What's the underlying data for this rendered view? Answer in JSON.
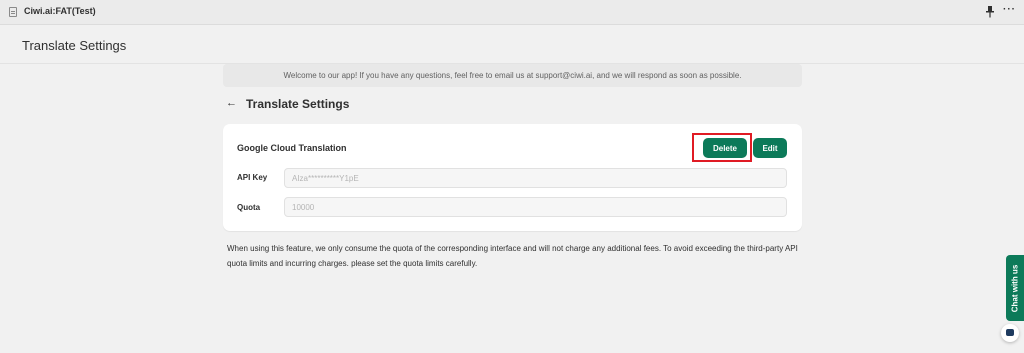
{
  "window": {
    "app_name": "Ciwi.ai:FAT(Test)",
    "more_label": "···"
  },
  "header": {
    "title": "Translate Settings"
  },
  "banner": {
    "text": "Welcome to our app! If you have any questions, feel free to email us at support@ciwi.ai, and we will respond as soon as possible."
  },
  "section": {
    "back_label": "←",
    "title": "Translate Settings"
  },
  "card": {
    "title": "Google Cloud Translation",
    "delete_label": "Delete",
    "edit_label": "Edit",
    "api_key_label": "API Key",
    "api_key_value": "AIza**********Y1pE",
    "quota_label": "Quota",
    "quota_value": "10000"
  },
  "footnote": "When using this feature, we only consume the quota of the corresponding interface and will not charge any additional fees. To avoid exceeding the third-party API quota limits and incurring charges. please set the quota limits carefully.",
  "chat": {
    "label": "Chat with us"
  },
  "colors": {
    "primary": "#0c7a59",
    "highlight": "#e01b24"
  }
}
